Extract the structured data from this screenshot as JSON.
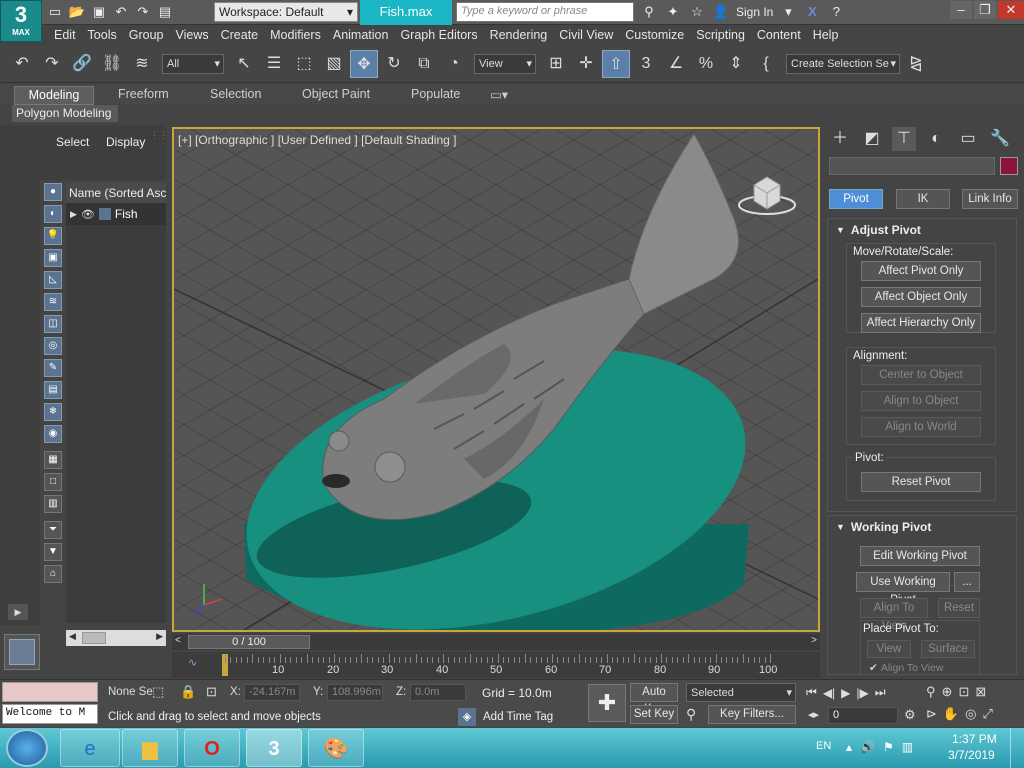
{
  "app": {
    "logo_main": "3",
    "logo_sub": "MAX",
    "workspace": "Workspace: Default",
    "file_tab": "Fish.max",
    "search_placeholder": "Type a keyword or phrase",
    "sign_in": "Sign In"
  },
  "menu": [
    "Edit",
    "Tools",
    "Group",
    "Views",
    "Create",
    "Modifiers",
    "Animation",
    "Graph Editors",
    "Rendering",
    "Civil View",
    "Customize",
    "Scripting",
    "Content",
    "Help"
  ],
  "toolbar": {
    "filter": "All",
    "view": "View",
    "selection_set": "Create Selection Se"
  },
  "ribbon": {
    "tabs": [
      "Modeling",
      "Freeform",
      "Selection",
      "Object Paint",
      "Populate"
    ],
    "active_tab": "Modeling",
    "panel": "Polygon Modeling"
  },
  "scene_explorer": {
    "tabs": [
      "Select",
      "Display"
    ],
    "column_header": "Name (Sorted Ascer",
    "items": [
      "Fish"
    ]
  },
  "viewport": {
    "label": "[+] [Orthographic ] [User Defined ] [Default Shading ]"
  },
  "command_panel": {
    "tabs": [
      "Pivot",
      "IK",
      "Link Info"
    ],
    "active_tab": "Pivot",
    "adjust_pivot": {
      "title": "Adjust Pivot",
      "move_group": "Move/Rotate/Scale:",
      "move_buttons": [
        "Affect Pivot Only",
        "Affect Object Only",
        "Affect Hierarchy Only"
      ],
      "align_group": "Alignment:",
      "align_buttons": [
        "Center to Object",
        "Align to Object",
        "Align to World"
      ],
      "pivot_group": "Pivot:",
      "reset_button": "Reset Pivot"
    },
    "working_pivot": {
      "title": "Working Pivot",
      "edit_button": "Edit Working Pivot",
      "use_button": "Use Working Pivot",
      "more_button": "...",
      "align_view": "Align To View",
      "reset": "Reset",
      "place_label": "Place Pivot To:",
      "view": "View",
      "surface": "Surface",
      "align_to_view_cut": "Align To View"
    },
    "accent_color": "#8b1538"
  },
  "timeline": {
    "frame": "0 / 100",
    "ticks": [
      "10",
      "20",
      "30",
      "40",
      "50",
      "60",
      "70",
      "80",
      "90",
      "100"
    ]
  },
  "status": {
    "none_selected": "None Se",
    "x_label": "X:",
    "x_value": "-24.167m",
    "y_label": "Y:",
    "y_value": "108.996m",
    "z_label": "Z:",
    "z_value": "0.0m",
    "grid": "Grid = 10.0m",
    "prompt": "Click and drag to select and move objects",
    "add_time_tag": "Add Time Tag",
    "auto_key": "Auto Key",
    "set_key": "Set Key",
    "selected": "Selected",
    "key_filters": "Key Filters...",
    "frame_field": "0",
    "listener": "Welcome to M"
  },
  "taskbar": {
    "lang": "EN",
    "time": "1:37 PM",
    "date": "3/7/2019"
  },
  "colors": {
    "viewport_border": "#c8a83c",
    "base_disc": "#17907f",
    "file_tab": "#1ab6c4"
  }
}
